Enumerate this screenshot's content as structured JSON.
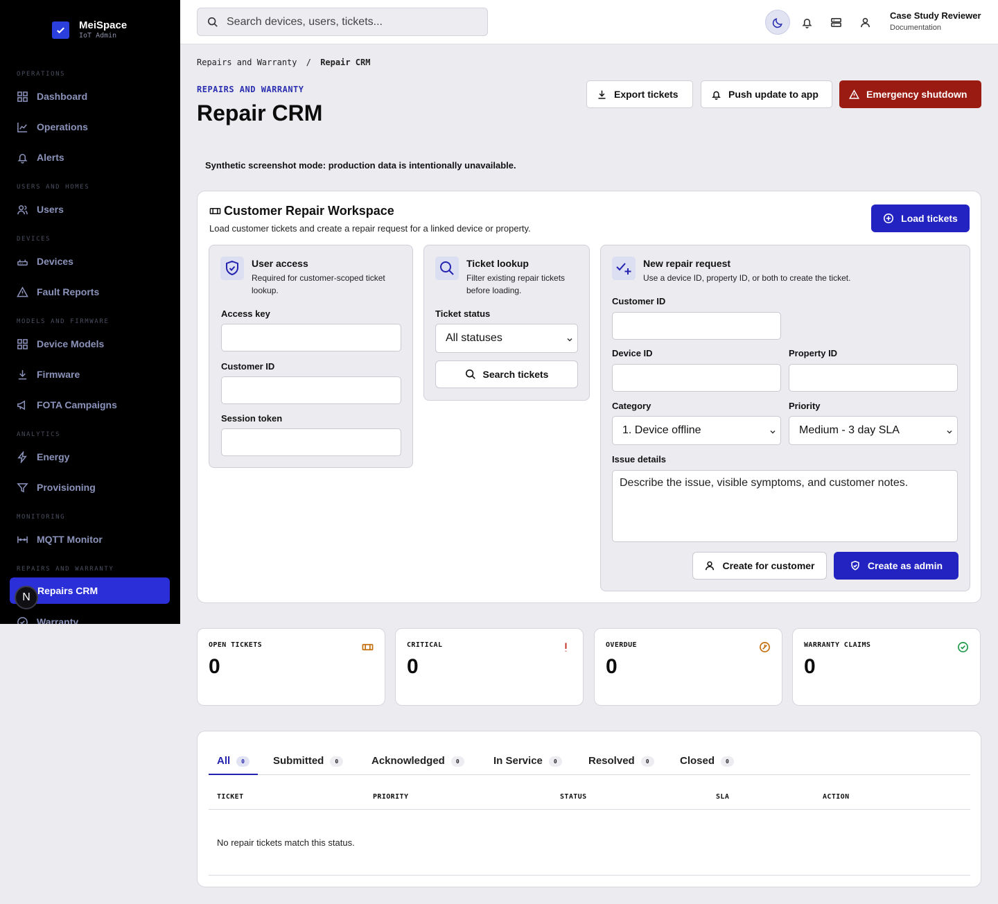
{
  "app": {
    "name": "MeiSpace",
    "subtitle": "IoT Admin"
  },
  "sidebar": {
    "sections": [
      "OPERATIONS",
      "USERS AND HOMES",
      "DEVICES",
      "MODELS AND FIRMWARE",
      "ANALYTICS",
      "MONITORING",
      "REPAIRS AND WARRANTY"
    ],
    "items": [
      "Dashboard",
      "Operations",
      "Alerts",
      "Users",
      "Devices",
      "Fault Reports",
      "Device Models",
      "Firmware",
      "FOTA Campaigns",
      "Energy",
      "Provisioning",
      "MQTT Monitor",
      "Repairs CRM",
      "Warranty"
    ],
    "badge": "N"
  },
  "topbar": {
    "search_placeholder": "Search devices, users, tickets...",
    "user_name": "Case Study Reviewer",
    "user_role": "Documentation"
  },
  "breadcrumb": {
    "parent": "Repairs and Warranty",
    "separator": "/",
    "current": "Repair CRM"
  },
  "header": {
    "eyebrow": "REPAIRS AND WARRANTY",
    "title": "Repair CRM",
    "export_label": "Export tickets",
    "push_label": "Push update to app",
    "shutdown_label": "Emergency shutdown"
  },
  "notice": "Synthetic screenshot mode: production data is intentionally unavailable.",
  "workspace": {
    "title": "Customer Repair Workspace",
    "subtitle": "Load customer tickets and create a repair request for a linked device or property.",
    "load_label": "Load tickets",
    "access": {
      "title": "User access",
      "desc": "Required for customer-scoped ticket lookup.",
      "access_key_label": "Access key",
      "customer_id_label": "Customer ID",
      "session_token_label": "Session token"
    },
    "lookup": {
      "title": "Ticket lookup",
      "desc": "Filter existing repair tickets before loading.",
      "status_label": "Ticket status",
      "status_value": "All statuses",
      "search_label": "Search tickets"
    },
    "request": {
      "title": "New repair request",
      "desc": "Use a device ID, property ID, or both to create the ticket.",
      "customer_id_label": "Customer ID",
      "device_id_label": "Device ID",
      "property_id_label": "Property ID",
      "category_label": "Category",
      "category_value": "1. Device offline",
      "priority_label": "Priority",
      "priority_value": "Medium - 3 day SLA",
      "details_label": "Issue details",
      "details_placeholder": "Describe the issue, visible symptoms, and customer notes.",
      "create_customer_label": "Create for customer",
      "create_admin_label": "Create as admin"
    }
  },
  "stats": [
    {
      "label": "OPEN TICKETS",
      "value": "0",
      "icon": "ticket-icon",
      "color": "#c2700e"
    },
    {
      "label": "CRITICAL",
      "value": "0",
      "icon": "exclamation-icon",
      "color": "#c0281c"
    },
    {
      "label": "OVERDUE",
      "value": "0",
      "icon": "clock-slash-icon",
      "color": "#c2700e"
    },
    {
      "label": "WARRANTY CLAIMS",
      "value": "0",
      "icon": "check-circle-icon",
      "color": "#1f9a4a"
    }
  ],
  "tickets": {
    "tabs": [
      {
        "label": "All",
        "count": "0"
      },
      {
        "label": "Submitted",
        "count": "0"
      },
      {
        "label": "Acknowledged",
        "count": "0"
      },
      {
        "label": "In Service",
        "count": "0"
      },
      {
        "label": "Resolved",
        "count": "0"
      },
      {
        "label": "Closed",
        "count": "0"
      }
    ],
    "columns": [
      "TICKET",
      "PRIORITY",
      "STATUS",
      "SLA",
      "ACTION"
    ],
    "empty_text": "No repair tickets match this status."
  },
  "colors": {
    "accent": "#2323c2",
    "danger": "#9a1b12",
    "sidebar": "#000000"
  }
}
